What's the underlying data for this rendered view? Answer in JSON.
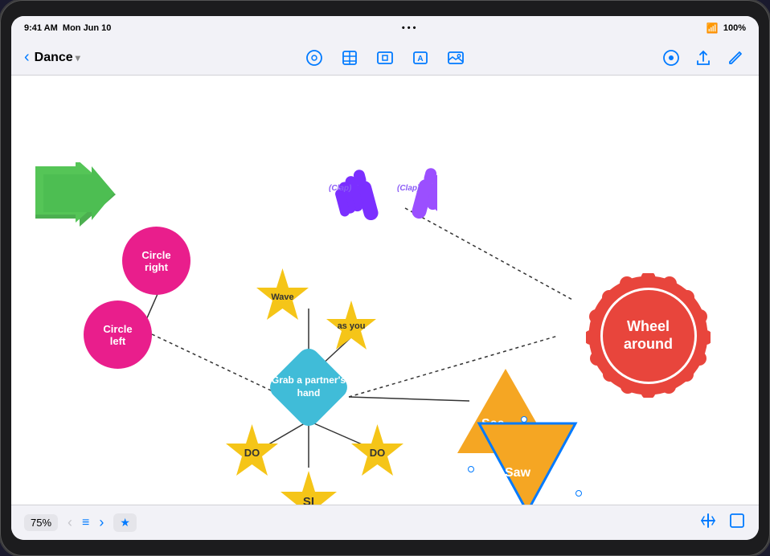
{
  "status_bar": {
    "time": "9:41 AM",
    "date": "Mon Jun 10",
    "dots": "...",
    "wifi": "wifi",
    "battery": "100%"
  },
  "toolbar": {
    "back_label": "‹",
    "title": "Dance",
    "dropdown_icon": "▾",
    "icons": {
      "shapes": "⊙",
      "table": "⊞",
      "media": "⊕",
      "text": "A",
      "photo": "⊡"
    },
    "right_icons": {
      "settings": "⊙",
      "share": "⬆",
      "edit": "✎"
    }
  },
  "canvas": {
    "nodes": {
      "circle_right": {
        "label": "Circle\nright"
      },
      "circle_left": {
        "label": "Circle\nleft"
      },
      "center": {
        "label": "Grab a\npartner's\nhand"
      },
      "wave": {
        "label": "Wave"
      },
      "as_you": {
        "label": "as\nyou"
      },
      "do_left": {
        "label": "DO"
      },
      "do_right": {
        "label": "DO"
      },
      "si": {
        "label": "SI"
      },
      "see": {
        "label": "See"
      },
      "saw": {
        "label": "Saw"
      },
      "wheel_around": {
        "label": "Wheel\naround"
      },
      "clap_left": {
        "label": "(Clap)"
      },
      "clap_right": {
        "label": "(Clap)"
      }
    }
  },
  "bottom_bar": {
    "zoom": "75%",
    "prev_btn": "‹",
    "list_btn": "≡",
    "next_btn": "›",
    "star_btn": "★"
  }
}
